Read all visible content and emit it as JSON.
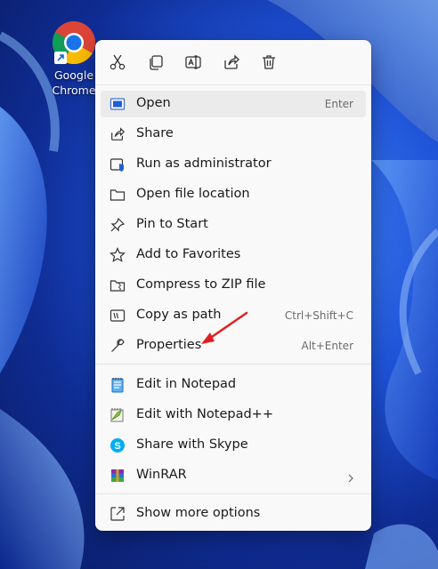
{
  "desktop": {
    "icon_label_line1": "Google",
    "icon_label_line2": "Chrome"
  },
  "toolbar": [
    {
      "name": "cut",
      "icon": "scissors-icon"
    },
    {
      "name": "copy",
      "icon": "copy-icon"
    },
    {
      "name": "rename",
      "icon": "rename-icon"
    },
    {
      "name": "share",
      "icon": "share-icon"
    },
    {
      "name": "delete",
      "icon": "trash-icon"
    }
  ],
  "menu": {
    "items": [
      {
        "label": "Open",
        "shortcut": "Enter",
        "icon": "app-window-icon"
      },
      {
        "label": "Share",
        "shortcut": "",
        "icon": "share-icon"
      },
      {
        "label": "Run as administrator",
        "shortcut": "",
        "icon": "shield-icon"
      },
      {
        "label": "Open file location",
        "shortcut": "",
        "icon": "folder-icon"
      },
      {
        "label": "Pin to Start",
        "shortcut": "",
        "icon": "pin-icon"
      },
      {
        "label": "Add to Favorites",
        "shortcut": "",
        "icon": "star-icon"
      },
      {
        "label": "Compress to ZIP file",
        "shortcut": "",
        "icon": "zip-folder-icon"
      },
      {
        "label": "Copy as path",
        "shortcut": "Ctrl+Shift+C",
        "icon": "path-icon"
      },
      {
        "label": "Properties",
        "shortcut": "Alt+Enter",
        "icon": "wrench-icon"
      },
      {
        "label": "Edit in Notepad",
        "shortcut": "",
        "icon": "notepad-icon"
      },
      {
        "label": "Edit with Notepad++",
        "shortcut": "",
        "icon": "notepadpp-icon"
      },
      {
        "label": "Share with Skype",
        "shortcut": "",
        "icon": "skype-icon"
      },
      {
        "label": "WinRAR",
        "shortcut": "",
        "icon": "winrar-icon"
      },
      {
        "label": "Show more options",
        "shortcut": "",
        "icon": "more-options-icon"
      }
    ]
  },
  "colors": {
    "accent": "#005fb8",
    "annotation_arrow": "#e02020"
  }
}
